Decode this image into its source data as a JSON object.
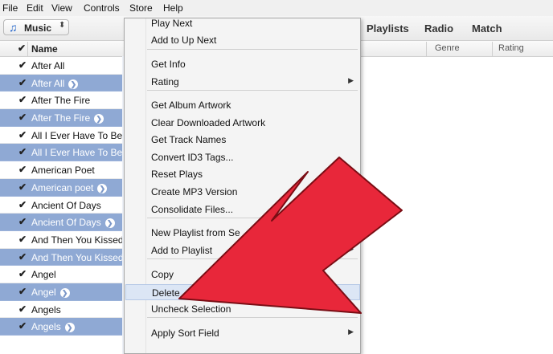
{
  "menubar": {
    "items": [
      "File",
      "Edit",
      "View",
      "Controls",
      "Store",
      "Help"
    ]
  },
  "toolbar": {
    "library_label": "Music",
    "library_icon": "music-note-icon",
    "tabs": [
      "Playlists",
      "Radio",
      "Match"
    ]
  },
  "columns": {
    "check": "✔",
    "name": "Name",
    "genre": "Genre",
    "rating": "Rating"
  },
  "rows": [
    {
      "name": "After All",
      "selected": false
    },
    {
      "name": "After All",
      "selected": true
    },
    {
      "name": "After The Fire",
      "selected": false
    },
    {
      "name": "After The Fire",
      "selected": true
    },
    {
      "name": "All I Ever Have To Be",
      "selected": false
    },
    {
      "name": "All I Ever Have To Be",
      "selected": true
    },
    {
      "name": "American Poet",
      "selected": false
    },
    {
      "name": "American poet",
      "selected": true
    },
    {
      "name": "Ancient Of Days",
      "selected": false
    },
    {
      "name": "Ancient Of Days",
      "selected": true
    },
    {
      "name": "And Then You Kissed",
      "selected": false
    },
    {
      "name": "And Then You Kissed",
      "selected": true
    },
    {
      "name": "Angel",
      "selected": false
    },
    {
      "name": "Angel",
      "selected": true
    },
    {
      "name": "Angels",
      "selected": false
    },
    {
      "name": "Angels",
      "selected": true
    }
  ],
  "context_menu": {
    "items": [
      {
        "label": "Play Next"
      },
      {
        "label": "Add to Up Next"
      },
      {
        "label": "Get Info"
      },
      {
        "label": "Rating",
        "submenu": true
      },
      {
        "label": "Get Album Artwork"
      },
      {
        "label": "Clear Downloaded Artwork"
      },
      {
        "label": "Get Track Names"
      },
      {
        "label": "Convert ID3 Tags..."
      },
      {
        "label": "Reset Plays"
      },
      {
        "label": "Create MP3 Version"
      },
      {
        "label": "Consolidate Files..."
      },
      {
        "label": "New Playlist from Se"
      },
      {
        "label": "Add to Playlist",
        "submenu": true
      },
      {
        "label": "Copy"
      },
      {
        "label": "Delete",
        "highlighted": true
      },
      {
        "label": "Uncheck Selection"
      },
      {
        "label": "Apply Sort Field",
        "submenu": true
      }
    ]
  },
  "colors": {
    "selection": "#8fa9d4",
    "menu_highlight": "#dce6f5",
    "arrow_fill": "#e8273a",
    "arrow_stroke": "#7a0d14"
  }
}
